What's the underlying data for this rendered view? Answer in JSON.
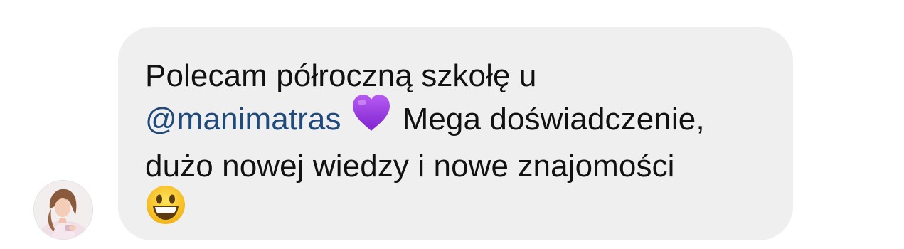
{
  "comment": {
    "line1": "Polecam półroczną szkołę u",
    "mention": "@manimatras",
    "heart_emoji": "purple-heart",
    "line2_rest": "Mega doświadczenie,",
    "line3": "dużo nowej wiedzy i nowe znajomości",
    "end_emoji": "grinning-face"
  },
  "colors": {
    "bubble": "#efefef",
    "text": "#111111",
    "mention": "#1f4a7c",
    "heart": "#9b3be0"
  },
  "avatar": {
    "icon": "user-avatar-photo"
  }
}
